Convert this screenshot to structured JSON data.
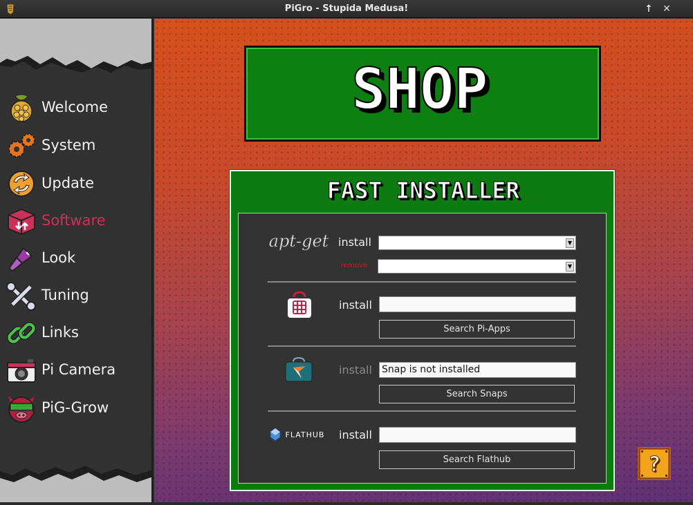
{
  "window": {
    "title": "PiGro - Stupida Medusa!",
    "btn_up": "↑",
    "btn_close": "✕"
  },
  "sidebar": {
    "items": [
      {
        "label": "Welcome",
        "icon": "raspberry-icon"
      },
      {
        "label": "System",
        "icon": "gears-icon"
      },
      {
        "label": "Update",
        "icon": "update-arrows-icon"
      },
      {
        "label": "Software",
        "icon": "software-box-icon",
        "active": true
      },
      {
        "label": "Look",
        "icon": "paintbrush-icon"
      },
      {
        "label": "Tuning",
        "icon": "tuning-tools-icon"
      },
      {
        "label": "Links",
        "icon": "chain-link-icon"
      },
      {
        "label": "Pi Camera",
        "icon": "camera-icon"
      },
      {
        "label": "PiG-Grow",
        "icon": "pig-mascot-icon"
      }
    ]
  },
  "main": {
    "banner": "SHOP",
    "panel_title": "FAST INSTALLER",
    "apt": {
      "logo": "apt-get",
      "install_label": "install",
      "remove_label": "remove",
      "install_value": "",
      "remove_value": ""
    },
    "piapps": {
      "install_label": "install",
      "value": "",
      "button": "Search Pi-Apps"
    },
    "snap": {
      "install_label": "install",
      "value": "Snap is not installed",
      "button": "Search Snaps"
    },
    "flathub": {
      "logo": "FLATHUB",
      "install_label": "install",
      "value": "",
      "button": "Search Flathub"
    },
    "help_icon": "?"
  },
  "colors": {
    "accent_green": "#0e8012",
    "active_nav": "#c9335a",
    "remove_red": "#d01c1c"
  }
}
